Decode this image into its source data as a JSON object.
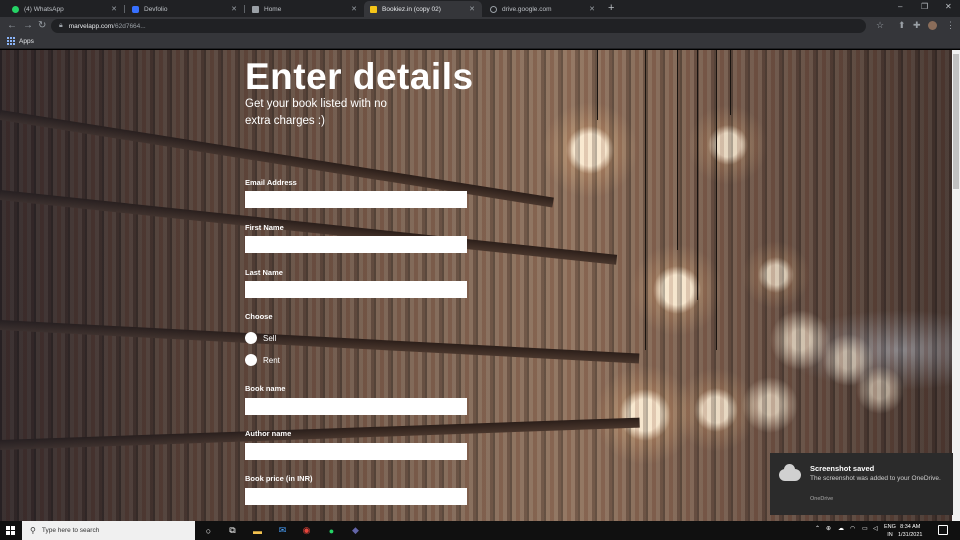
{
  "browser": {
    "tabs": [
      {
        "label": "(4) WhatsApp",
        "color": "#25d366",
        "active": false
      },
      {
        "label": "Devfolio",
        "color": "#3770ff",
        "active": false
      },
      {
        "label": "Home",
        "color": "#9aa0a6",
        "active": false
      },
      {
        "label": "Bookiez.in (copy 02)",
        "color": "#f5c518",
        "active": true
      },
      {
        "label": "drive.google.com",
        "color": "#9aa0a6",
        "active": false
      }
    ],
    "new_tab": "+",
    "minimize": "–",
    "maximize": "❐",
    "close": "✕",
    "url_host": "marvelapp.com",
    "url_path": "/62d7664...",
    "bookmarks_apps": "Apps"
  },
  "form": {
    "title": "Enter details",
    "subtitle": "Get your book listed with no extra charges :)",
    "email_label": "Email Address",
    "first_name_label": "First Name",
    "last_name_label": "Last Name",
    "choose_label": "Choose",
    "options": [
      "Sell",
      "Rent"
    ],
    "book_name_label": "Book name",
    "author_name_label": "Author name",
    "book_price_label": "Book price (in INR)"
  },
  "toast": {
    "title": "Screenshot saved",
    "message": "The screenshot was added to your OneDrive.",
    "source": "OneDrive"
  },
  "taskbar": {
    "search_placeholder": "Type here to search",
    "lang_1": "ENG",
    "lang_2": "IN",
    "time": "8:34 AM",
    "date": "1/31/2021"
  }
}
